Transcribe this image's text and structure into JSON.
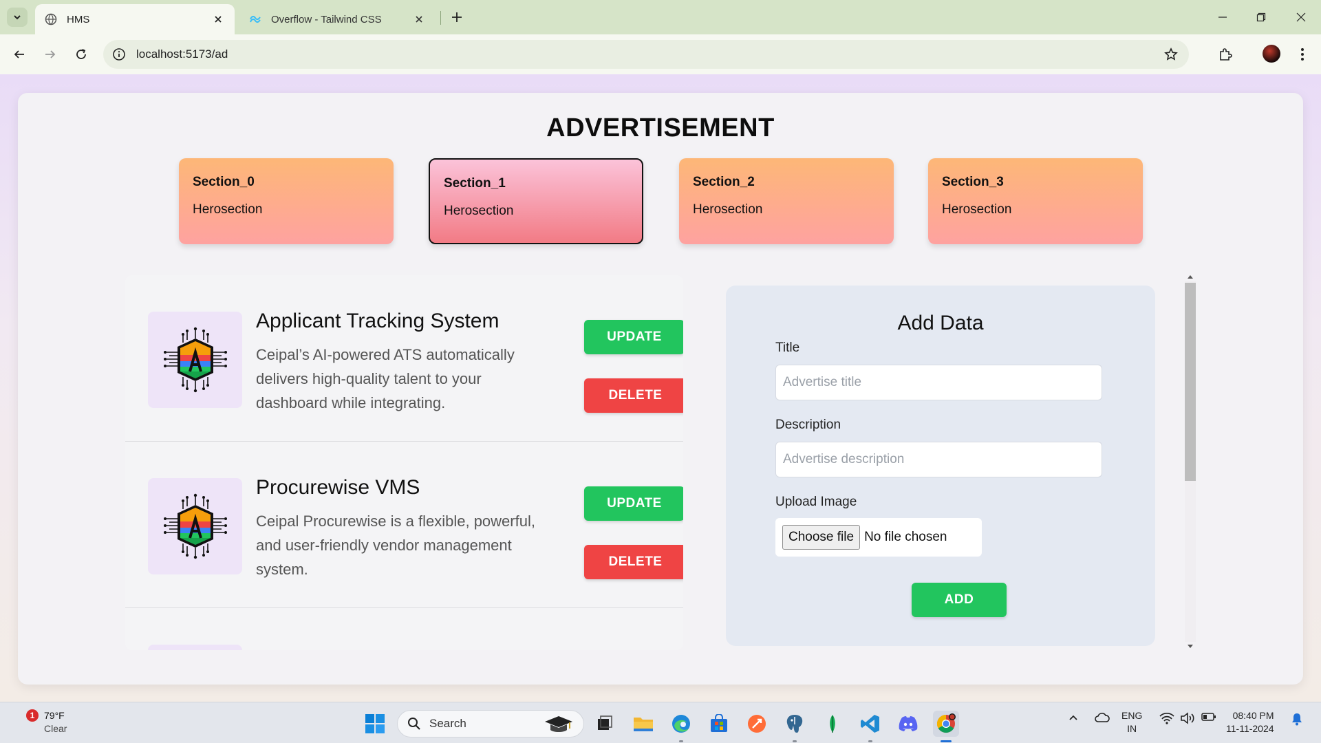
{
  "browser": {
    "tabs": [
      {
        "title": "HMS",
        "active": true
      },
      {
        "title": "Overflow - Tailwind CSS",
        "active": false
      }
    ],
    "url": "localhost:5173/ad"
  },
  "page": {
    "title": "ADVERTISEMENT",
    "sections": [
      {
        "name": "Section_0",
        "type": "Herosection"
      },
      {
        "name": "Section_1",
        "type": "Herosection",
        "active": true
      },
      {
        "name": "Section_2",
        "type": "Herosection"
      },
      {
        "name": "Section_3",
        "type": "Herosection"
      }
    ],
    "items": [
      {
        "title": "Applicant Tracking System",
        "description": "Ceipal’s AI-powered ATS automatically delivers high-quality talent to your dashboard while integrating.",
        "update_label": "UPDATE",
        "delete_label": "DELETE"
      },
      {
        "title": "Procurewise VMS",
        "description": "Ceipal Procurewise is a flexible, powerful, and user-friendly vendor management system.",
        "update_label": "UPDATE",
        "delete_label": "DELETE"
      }
    ],
    "form": {
      "title": "Add Data",
      "title_label": "Title",
      "title_placeholder": "Advertise title",
      "description_label": "Description",
      "description_placeholder": "Advertise description",
      "upload_label": "Upload Image",
      "choose_file_label": "Choose file",
      "file_status": "No file chosen",
      "add_label": "ADD"
    }
  },
  "taskbar": {
    "weather": {
      "badge": "1",
      "temp": "79°F",
      "condition": "Clear"
    },
    "search_label": "Search",
    "lang": {
      "line1": "ENG",
      "line2": "IN"
    },
    "clock": {
      "time": "08:40 PM",
      "date": "11-11-2024"
    }
  },
  "colors": {
    "update_button": "#22c55e",
    "delete_button": "#ef4444",
    "section_card_gradient_top": "#fdb777",
    "section_card_gradient_bottom": "#fea2a0",
    "active_section_gradient_top": "#fbc3d9",
    "active_section_gradient_bottom": "#f27b85"
  }
}
